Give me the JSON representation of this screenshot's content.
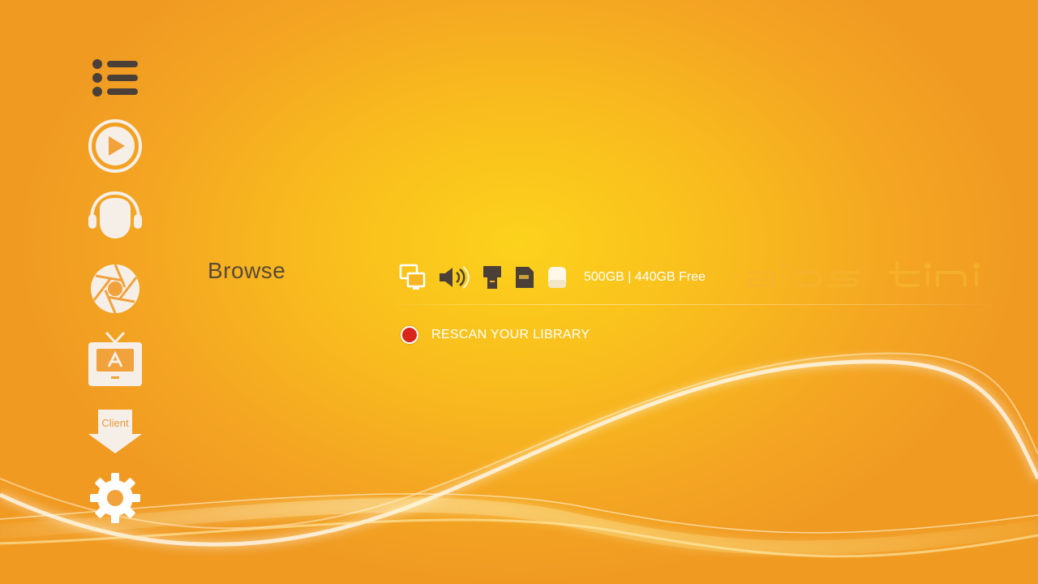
{
  "sidebar": {
    "items": [
      {
        "icon": "list-icon",
        "label": ""
      },
      {
        "icon": "play-icon",
        "label": ""
      },
      {
        "icon": "headphones-icon",
        "label": ""
      },
      {
        "icon": "aperture-icon",
        "label": ""
      },
      {
        "icon": "tv-icon",
        "label": ""
      },
      {
        "icon": "client-download-icon",
        "label": "Client"
      },
      {
        "icon": "gear-icon",
        "label": ""
      }
    ]
  },
  "main": {
    "section_title": "Browse",
    "status_icons": [
      "network-icon",
      "volume-icon",
      "usb-drive-icon",
      "flash-card-icon",
      "disk-icon"
    ],
    "storage_text": "500GB | 440GB Free",
    "brand_text": "aios tini",
    "rescan_label": "RESCAN YOUR LIBRARY"
  },
  "colors": {
    "background_center": "#fcd21c",
    "background_edge": "#f09a22",
    "icon_dark": "#4a4038",
    "icon_light": "#f5efe8",
    "rescan_dot": "#d8261a",
    "text_white": "#ffffff",
    "title_color": "#5a4a36"
  }
}
